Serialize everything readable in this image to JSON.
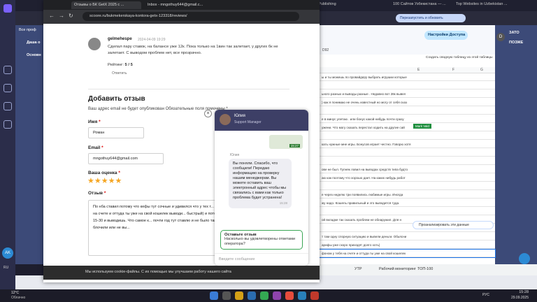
{
  "background": {
    "tabs": [
      "Tilda Publishing",
      "100 Сайтов Узбекистана — ...",
      "Top Websites in Uzbekistan ..."
    ],
    "sheet_toolbar_label": "Настройки Доступа",
    "sheet_left_labels": [
      "Все проф",
      "Даша о",
      "Основн"
    ],
    "cell_ref": "D92",
    "row_numbers": [
      "91",
      "92",
      "93",
      "94",
      "95",
      "96",
      "97",
      "98",
      "99",
      "100"
    ],
    "grid_header_right": "Создать сводную таблицу из этой таблицы",
    "grid_cols": [
      "E",
      "F",
      "G"
    ],
    "grid_rows": [
      "ы и ты можешь по провайдеру выбрать игрушки которые",
      "",
      "ьного разных и выводы разные . Недавно вот 28к вывел",
      ") как я понимаю не очень известный но могу от себя сказ",
      "",
      "е в минус улетаю . или бонус какой нибудь почти сразу",
      "ужени. Что могу сказать перестал ходить на другие сай",
      "",
      "кать нужные мне игры. Бонусов играет честно. Говорю хотя",
      "",
      "",
      "ове не был. Тупняк ловил на выводах средств типа будтo",
      "аю как поэтому что хорошо дает. На каких нибудь работ",
      "",
      "е через неделю три появились любимые игры. Иногда",
      "жу надо. Кошель правильный и это выводится туда.",
      "",
      "ой вкладке так сказать проблем не обнаружил. Для н",
      "",
      "т там одну спорную ситуацию и вывели деньги. Обьясни",
      "арифы уже скоро приходят долго хоть)",
      "фоном у тебя на счете и оттуда ты уже на свой кошелек"
    ],
    "mark_label": "Mark Vald",
    "suggest_label": "Проанализировать эти данные",
    "sheet_tabs": [
      "УТР",
      "Рабочий мониторинг",
      "ТОП-100"
    ],
    "right_panel_labels": [
      "ЗАТО",
      "ПОЗЖЕ"
    ]
  },
  "window": {
    "tabs": [
      "Отзывы о БК GetX 2025 с ...",
      "Inbox - mngothuy644@gmail.c...",
      "Top Websites in Uzbekistan"
    ],
    "url": "scoore.ru/bukmekerskaya-kontora-getx-123318/reviews/",
    "right_buttons": [
      "Перезапустить и обновить"
    ]
  },
  "review": {
    "author": "gelmehespe",
    "date": "2024-04-09 19:29",
    "text": "Сделал пару ставок, на балансе уже 12к. Пока только на 1вин так залетает, у других бк не залетает. С выводом проблем нет, все прозрачно.",
    "rating_label": "Рейтинг:",
    "rating": "5 / 5",
    "reply": "Ответить"
  },
  "form": {
    "title": "Добавить отзыв",
    "note": "Ваш адрес email не будет опубликован Обязательные поля помечены *",
    "name_label": "Имя",
    "name_value": "Роман",
    "email_label": "Email",
    "email_value": "mngothuy644@gmail.com",
    "rating_label": "Ваша оценка",
    "stars": 5,
    "review_label": "Отзыв",
    "review_text": "По нба ставил потому что кефы тут сочные и удивился что у тех т... автоматом у тебя на счете и оттуда ты уже на свой кошелек выводи... быстрый) и потом уже может минут 15-30 и выводишь. Что самое к... почти год тут ставлю и не было такого чтобы зак блочили или не вы..."
  },
  "chat": {
    "agent_name": "Юлия",
    "agent_role": "Support Manager",
    "time1": "15:27",
    "sender": "Юлия",
    "message": "Вы поняли. Спасибо, что сообщили! Передаю информацию на проверку нашим менеджерам. Вы можете оставить ваш электронный адрес чтобы мы связались с вами как только проблема будет устранена!",
    "time2": "15:28",
    "rating_title": "Оставьте отзыв",
    "rating_question": "Насколько вы удовлетворены ответами оператора?",
    "input_placeholder": "Введите сообщение"
  },
  "cookie": {
    "text": "Мы используем cookie-файлы. С их помощью мы улучшаем работу нашего сайта"
  },
  "taskbar": {
    "weather_temp": "12°C",
    "weather_desc": "Облачно",
    "lang": "РУС",
    "time": "15:28",
    "date": "29.09.2025"
  },
  "user_initials": "AK",
  "colors": {
    "accent": "#3d3f66",
    "sheet_green": "#0f9d58",
    "star": "#f5a623",
    "chat_green": "#2e7d32"
  }
}
